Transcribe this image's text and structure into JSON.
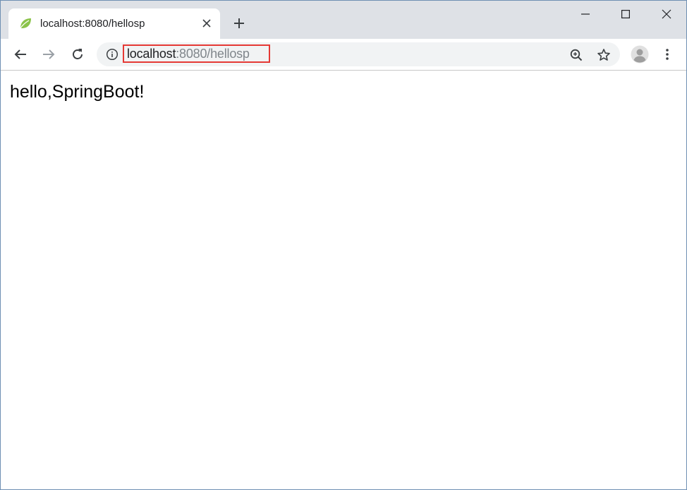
{
  "tab": {
    "title": "localhost:8080/hellosp",
    "favicon": "spring-leaf-icon"
  },
  "window_controls": {
    "minimize": "minimize-icon",
    "maximize": "maximize-icon",
    "close": "close-icon"
  },
  "address_bar": {
    "host": "localhost",
    "rest": ":8080/hellosp",
    "highlight_color": "#e53935"
  },
  "page": {
    "body_text": "hello,SpringBoot!"
  },
  "colors": {
    "titlebar": "#dee1e6",
    "omnibox": "#f1f3f4",
    "favicon": "#8bc34a"
  }
}
